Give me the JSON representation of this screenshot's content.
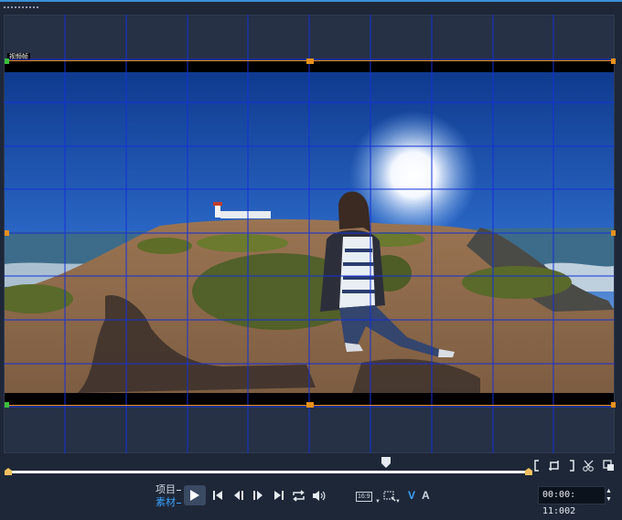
{
  "canvas": {
    "frame_label": "视频帧"
  },
  "mode": {
    "project_label": "项目",
    "clip_label": "素材"
  },
  "controls": {
    "aspect_ratio": "16:9",
    "v_label": "V",
    "a_label": "A",
    "timecode": "00:00: 11:002"
  },
  "colors": {
    "grid": "#1430d8",
    "handles": "#e8901c",
    "clip_accent": "#3aa3ff",
    "background": "#1e2737"
  },
  "icons": [
    "play-icon",
    "go-to-start-icon",
    "previous-frame-icon",
    "next-frame-icon",
    "go-to-end-icon",
    "repeat-icon",
    "volume-icon",
    "mark-in-icon",
    "mark-out-icon",
    "crop-icon",
    "split-clip-icon",
    "copy-icon",
    "scrubber-icon"
  ]
}
